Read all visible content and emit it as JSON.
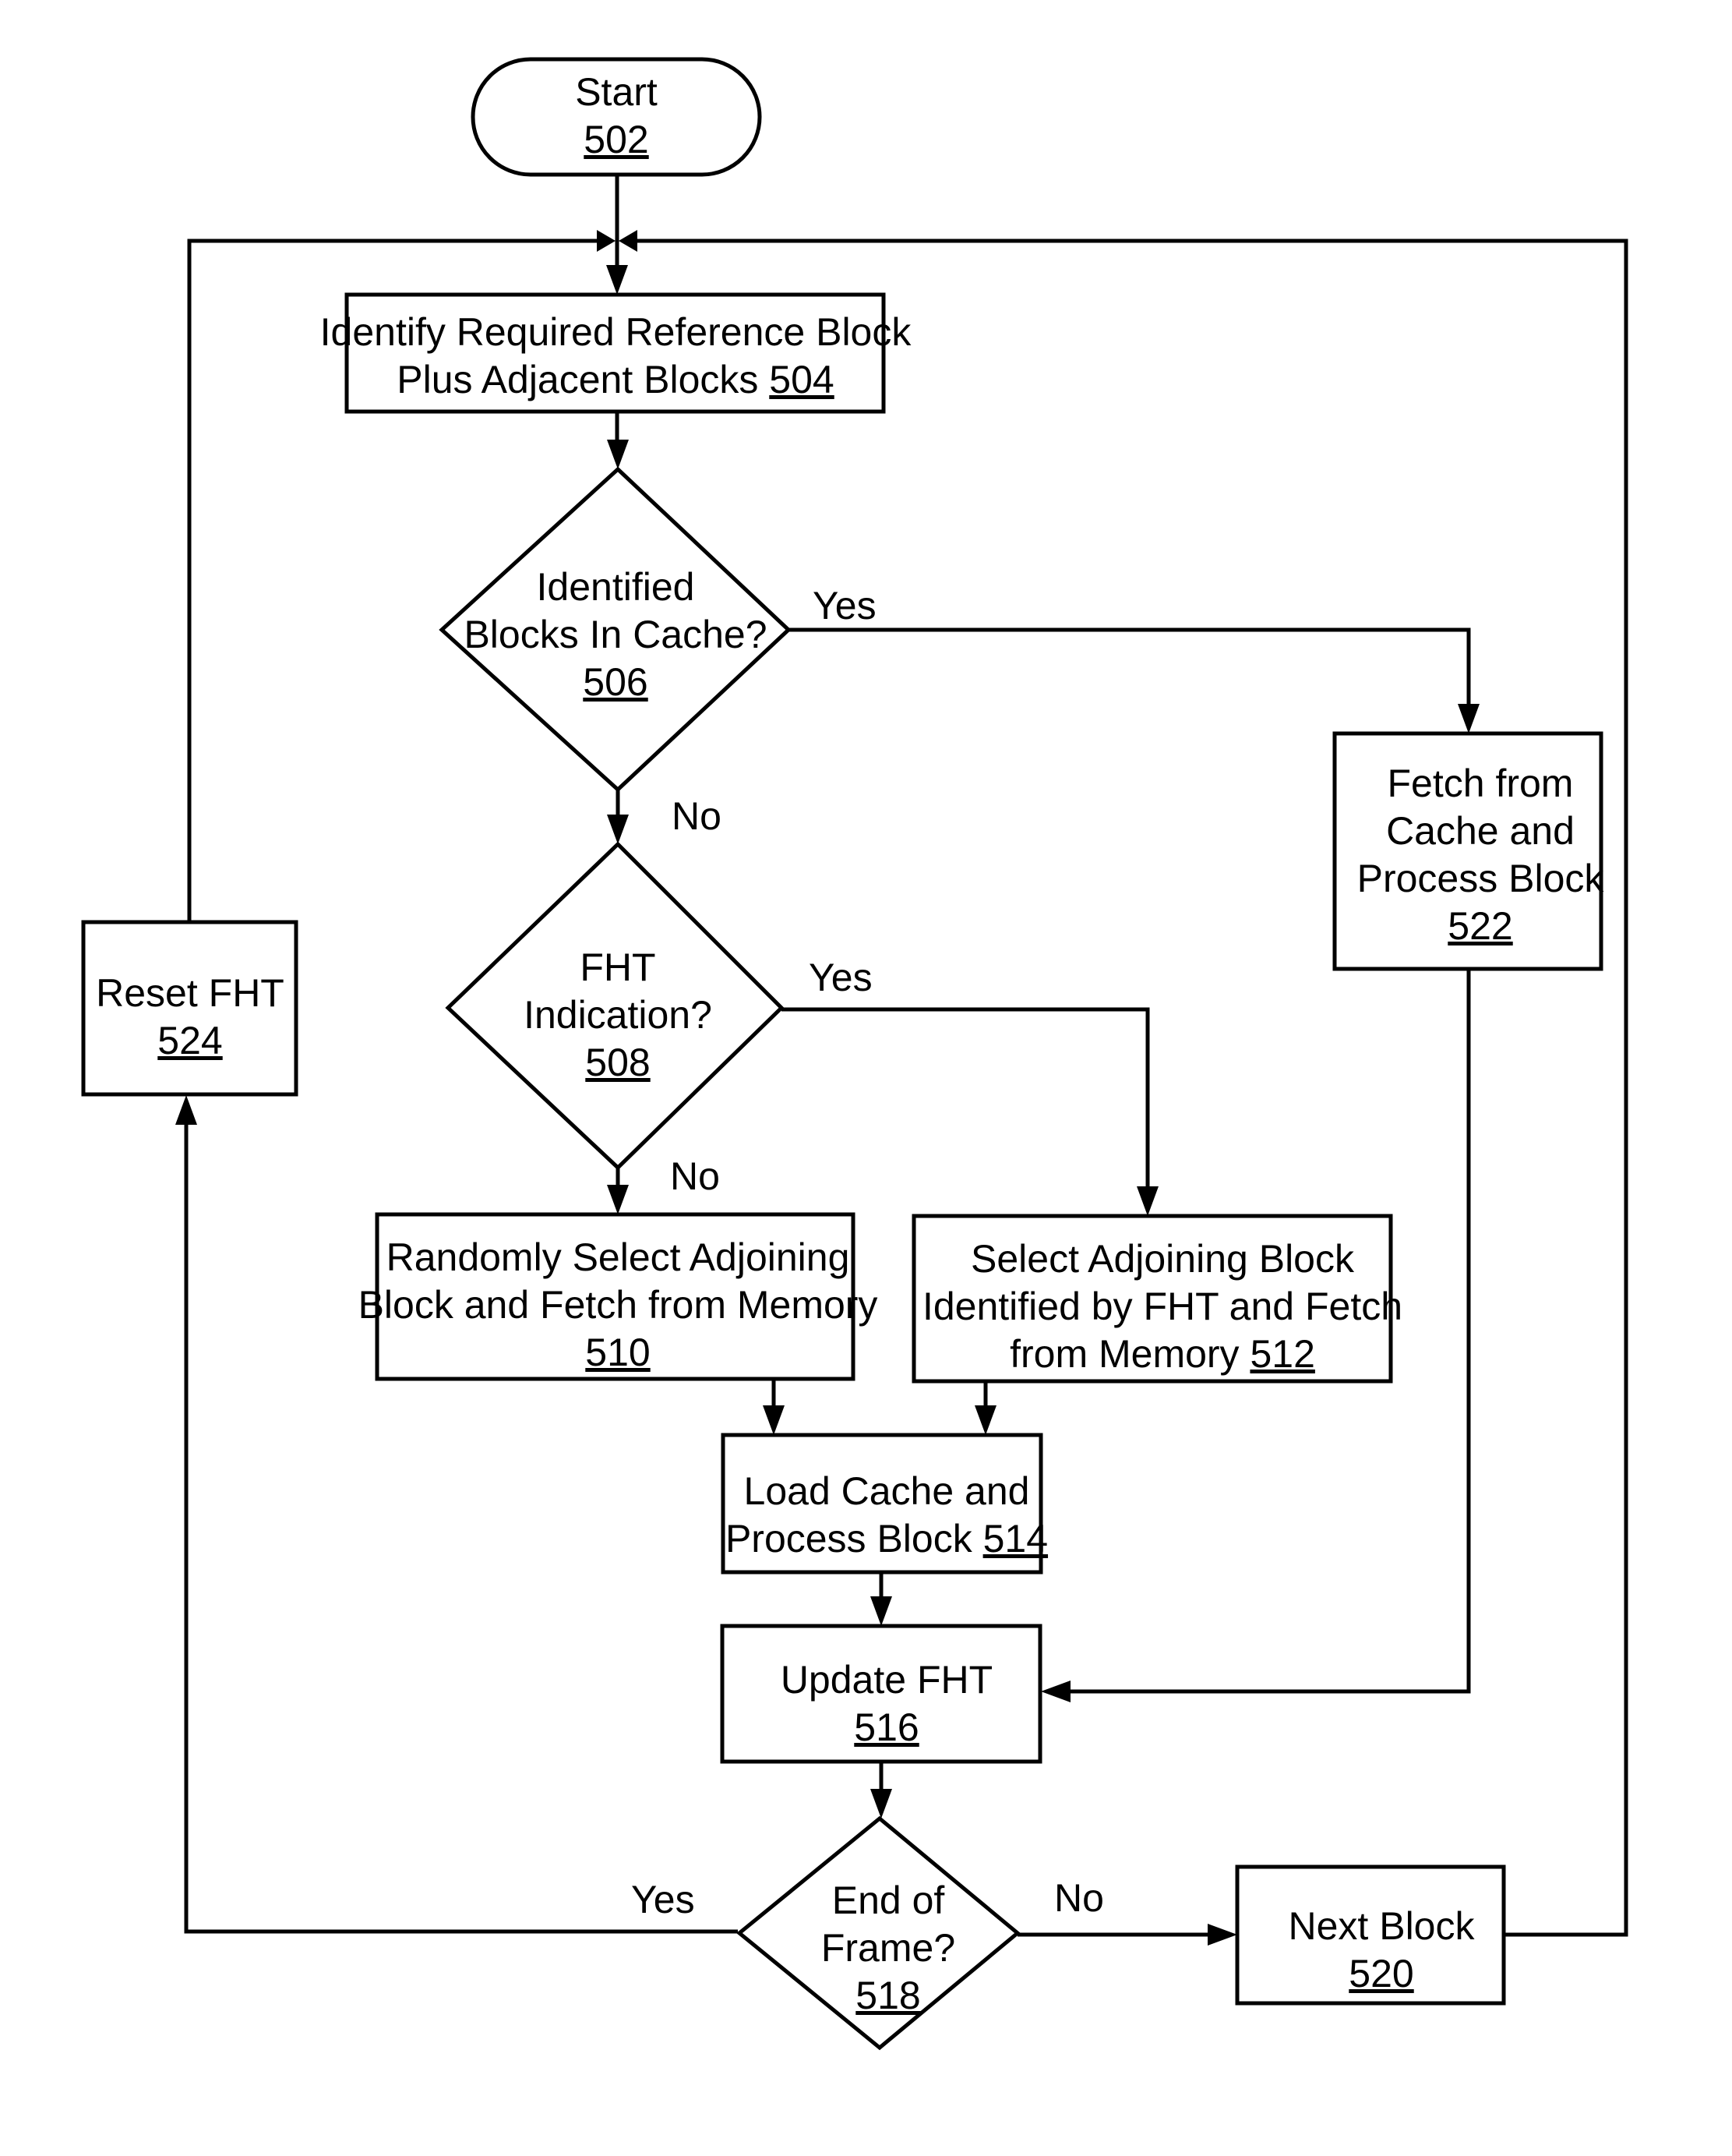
{
  "figure": {
    "type": "flowchart",
    "colors": {
      "stroke": "#000000",
      "background": "#ffffff"
    }
  },
  "nodes": {
    "start": {
      "shape": "terminal",
      "lines": [
        "Start"
      ],
      "ref": "502"
    },
    "identify": {
      "shape": "process",
      "lines": [
        "Identify Required Reference Block",
        "Plus Adjacent Blocks"
      ],
      "ref": "504"
    },
    "in_cache": {
      "shape": "decision",
      "lines": [
        "Identified",
        "Blocks In Cache?"
      ],
      "ref": "506"
    },
    "fht_ind": {
      "shape": "decision",
      "lines": [
        "FHT",
        "Indication?"
      ],
      "ref": "508"
    },
    "random_sel": {
      "shape": "process",
      "lines": [
        "Randomly Select Adjoining",
        "Block and Fetch from Memory"
      ],
      "ref": "510"
    },
    "fht_sel": {
      "shape": "process",
      "lines": [
        "Select Adjoining Block",
        "Identified by FHT and Fetch",
        "from Memory"
      ],
      "ref": "512"
    },
    "load_cache": {
      "shape": "process",
      "lines": [
        "Load Cache and",
        "Process Block"
      ],
      "ref": "514"
    },
    "update_fht": {
      "shape": "process",
      "lines": [
        "Update FHT"
      ],
      "ref": "516"
    },
    "end_frame": {
      "shape": "decision",
      "lines": [
        "End of",
        "Frame?"
      ],
      "ref": "518"
    },
    "next_block": {
      "shape": "process",
      "lines": [
        "Next Block"
      ],
      "ref": "520"
    },
    "fetch_cache": {
      "shape": "process",
      "lines": [
        "Fetch from",
        "Cache and",
        "Process Block"
      ],
      "ref": "522"
    },
    "reset_fht": {
      "shape": "process",
      "lines": [
        "Reset FHT"
      ],
      "ref": "524"
    }
  },
  "edges": [
    {
      "from": "start",
      "to": "identify",
      "label": ""
    },
    {
      "from": "identify",
      "to": "in_cache",
      "label": ""
    },
    {
      "from": "in_cache",
      "to": "fetch_cache",
      "label": "Yes"
    },
    {
      "from": "in_cache",
      "to": "fht_ind",
      "label": "No"
    },
    {
      "from": "fht_ind",
      "to": "fht_sel",
      "label": "Yes"
    },
    {
      "from": "fht_ind",
      "to": "random_sel",
      "label": "No"
    },
    {
      "from": "random_sel",
      "to": "load_cache",
      "label": ""
    },
    {
      "from": "fht_sel",
      "to": "load_cache",
      "label": ""
    },
    {
      "from": "load_cache",
      "to": "update_fht",
      "label": ""
    },
    {
      "from": "fetch_cache",
      "to": "update_fht",
      "label": ""
    },
    {
      "from": "update_fht",
      "to": "end_frame",
      "label": ""
    },
    {
      "from": "end_frame",
      "to": "reset_fht",
      "label": "Yes"
    },
    {
      "from": "end_frame",
      "to": "next_block",
      "label": "No"
    },
    {
      "from": "reset_fht",
      "to": "identify",
      "label": ""
    },
    {
      "from": "next_block",
      "to": "identify",
      "label": ""
    }
  ],
  "edge_labels": {
    "in_cache_yes": "Yes",
    "in_cache_no": "No",
    "fht_yes": "Yes",
    "fht_no": "No",
    "frame_yes": "Yes",
    "frame_no": "No"
  }
}
